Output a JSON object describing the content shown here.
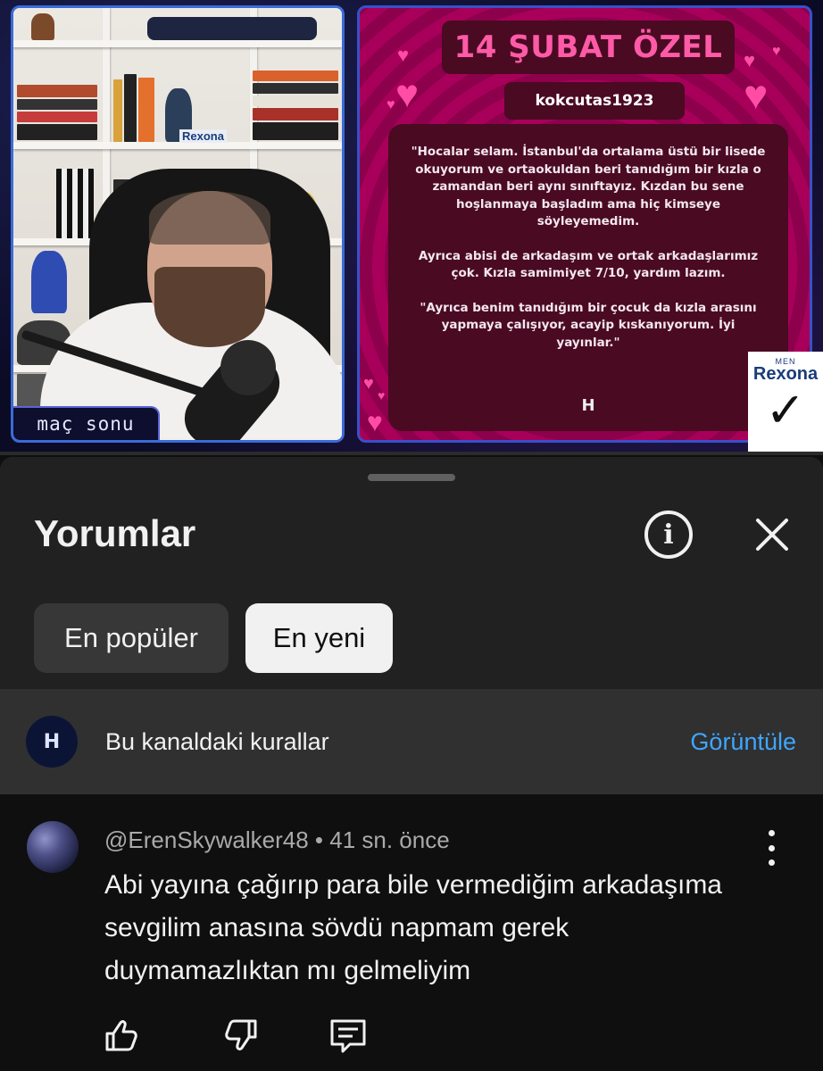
{
  "video": {
    "overlay_label": "maç sonu",
    "card": {
      "title": "14 ŞUBAT ÖZEL",
      "username": "kokcutas1923",
      "paragraphs": [
        "\"Hocalar selam. İstanbul'da ortalama üstü bir lisede okuyorum ve ortaokuldan beri tanıdığım bir kızla o zamandan beri aynı sınıftayız. Kızdan bu sene hoşlanmaya başladım ama hiç kimseye söyleyemedim.",
        "Ayrıca abisi de arkadaşım ve ortak arkadaşlarımız çok. Kızla samimiyet 7/10, yardım lazım.",
        "\"Ayrıca benim tanıdığım bir çocuk da kızla arasını yapmaya çalışıyor, acayip kıskanıyorum. İyi yayınlar.\""
      ],
      "logo_text": "H"
    },
    "sponsor": {
      "small": "MEN",
      "brand": "Rexona",
      "mark": "✓"
    },
    "shelf_brand": "Rexona"
  },
  "comments_panel": {
    "title": "Yorumlar",
    "info_icon": "info-icon",
    "close_icon": "close-icon",
    "chips": [
      {
        "label": "En popüler",
        "selected": false
      },
      {
        "label": "En yeni",
        "selected": true
      }
    ],
    "rules": {
      "avatar_text": "H",
      "text": "Bu kanaldaki kurallar",
      "link": "Görüntüle"
    },
    "comment": {
      "author": "@ErenSkywalker48",
      "time": "41 sn. önce",
      "meta": "@ErenSkywalker48 • 41 sn. önce",
      "text": "Abi yayına çağırıp para bile vermediğim arkadaşıma sevgilim anasına sövdü napmam gerek duymamazlıktan mı gelmeliyim",
      "actions": [
        "like-icon",
        "dislike-icon",
        "reply-icon"
      ]
    }
  },
  "colors": {
    "background": "#0f0f0f",
    "sheet": "#212121",
    "link": "#3ea6ff",
    "card_pink": "#ff5aa8"
  }
}
